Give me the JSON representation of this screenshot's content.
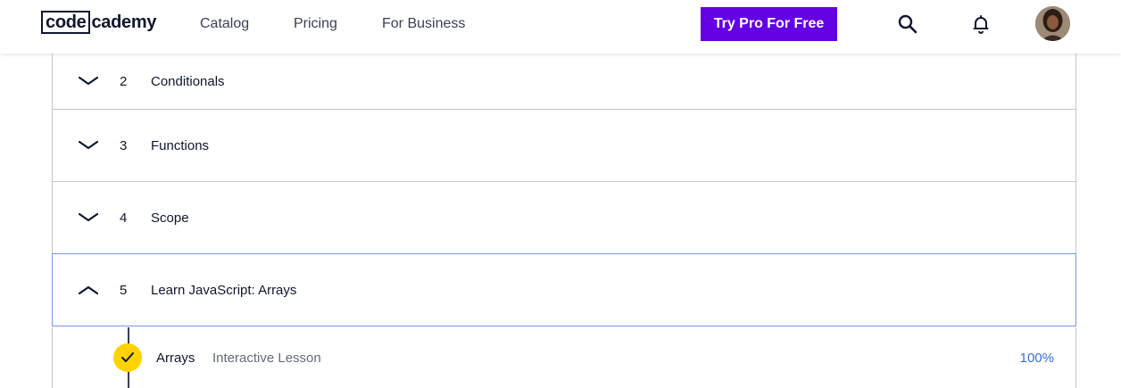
{
  "header": {
    "logo_box": "code",
    "logo_rest": "cademy",
    "nav": [
      {
        "label": "Catalog"
      },
      {
        "label": "Pricing"
      },
      {
        "label": "For Business"
      }
    ],
    "cta_label": "Try Pro For Free",
    "icons": [
      "search-icon",
      "bell-icon",
      "avatar"
    ],
    "colors": {
      "cta": "#6400e4",
      "text": "#10162f"
    }
  },
  "syllabus": {
    "modules": [
      {
        "number": "2",
        "title": "Conditionals",
        "expanded": false
      },
      {
        "number": "3",
        "title": "Functions",
        "expanded": false
      },
      {
        "number": "4",
        "title": "Scope",
        "expanded": false
      },
      {
        "number": "5",
        "title": "Learn JavaScript: Arrays",
        "expanded": true
      }
    ],
    "lessons": [
      {
        "name": "Arrays",
        "type": "Interactive Lesson",
        "progress": "100%",
        "completed": true
      }
    ],
    "colors": {
      "check": "#ffd300",
      "progress": "#3a6cd9",
      "active_border": "#7a96e6"
    }
  }
}
